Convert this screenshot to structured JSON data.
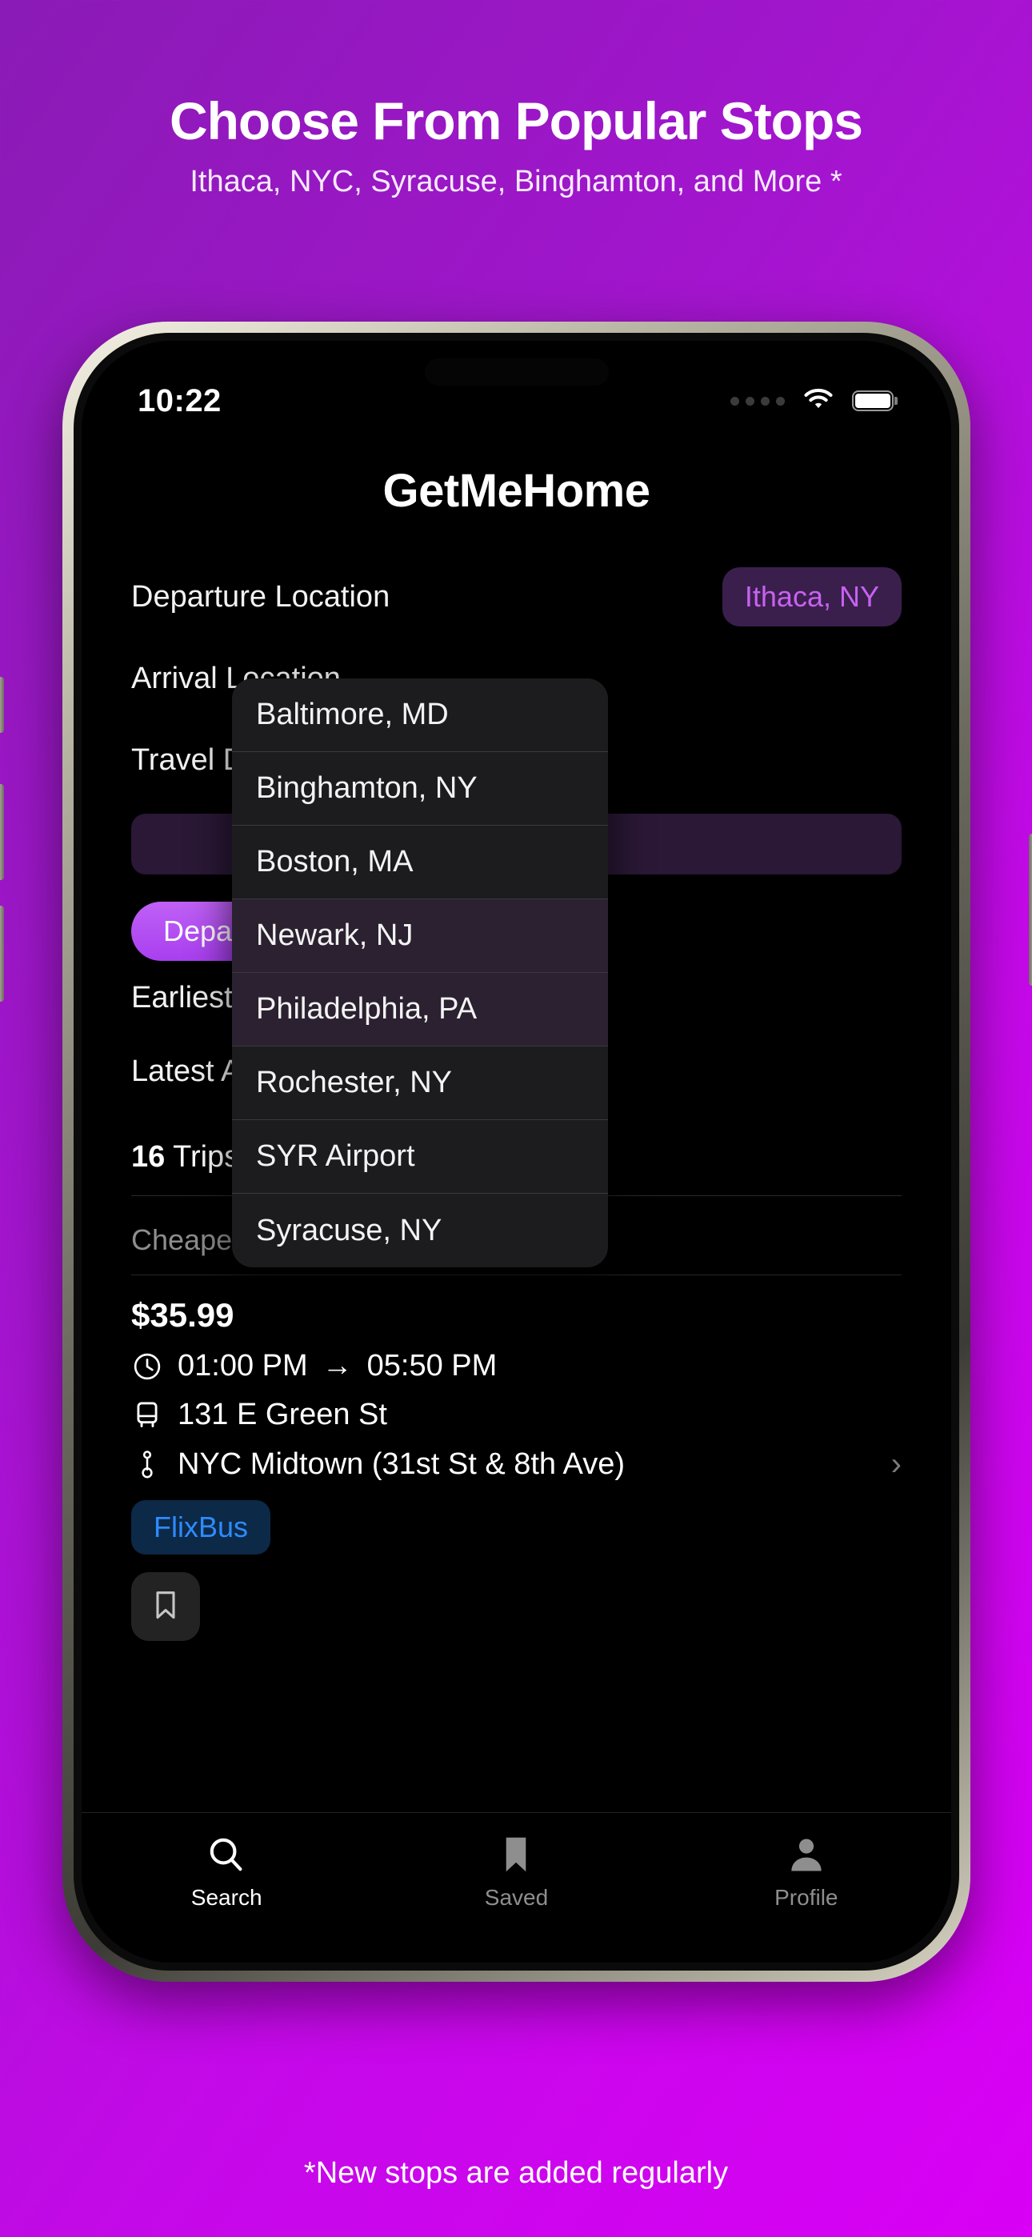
{
  "promo": {
    "title": "Choose From Popular Stops",
    "subtitle": "Ithaca, NYC, Syracuse, Binghamton, and More *",
    "footnote": "*New stops are added regularly"
  },
  "status_bar": {
    "time": "10:22",
    "cellular_icon": "signal-dots-icon",
    "wifi_icon": "wifi-icon",
    "battery_icon": "battery-full-icon"
  },
  "app": {
    "title": "GetMeHome",
    "form": {
      "departure_location_label": "Departure Location",
      "departure_location_value": "Ithaca, NY",
      "arrival_location_label": "Arrival Location",
      "travel_date_label": "Travel Date",
      "departure_time_chip": "Departure Time",
      "earliest_departure_label": "Earliest Departure",
      "latest_arrival_label": "Latest Arrival Time"
    },
    "results": {
      "trips_count": "16",
      "trips_word": "Trips",
      "section_label": "Cheapest Trip",
      "trip": {
        "price": "$35.99",
        "depart_time": "01:00 PM",
        "arrow": "→",
        "arrive_time": "05:50 PM",
        "origin_stop": "131 E Green St",
        "destination_stop": "NYC Midtown (31st St & 8th Ave)",
        "operator": "FlixBus",
        "chevron": "›",
        "clock_icon": "clock-icon",
        "bus_icon": "bus-icon",
        "pin_icon": "map-pin-icon",
        "bookmark_icon": "bookmark-icon"
      }
    },
    "dropdown": {
      "items": [
        "Baltimore, MD",
        "Binghamton, NY",
        "Boston, MA",
        "Newark, NJ",
        "Philadelphia, PA",
        "Rochester, NY",
        "SYR Airport",
        "Syracuse, NY"
      ]
    },
    "tabs": [
      {
        "label": "Search",
        "icon": "search-icon"
      },
      {
        "label": "Saved",
        "icon": "bookmark-icon"
      },
      {
        "label": "Profile",
        "icon": "person-icon"
      }
    ]
  },
  "colors": {
    "brand_purple": "#A315CE",
    "accent_chip": "#bf61f5",
    "pill_bg": "#3a1f4d",
    "pill_text": "#c861f0",
    "flixbus_bg": "#0c2947",
    "flixbus_text": "#2e8bff"
  }
}
